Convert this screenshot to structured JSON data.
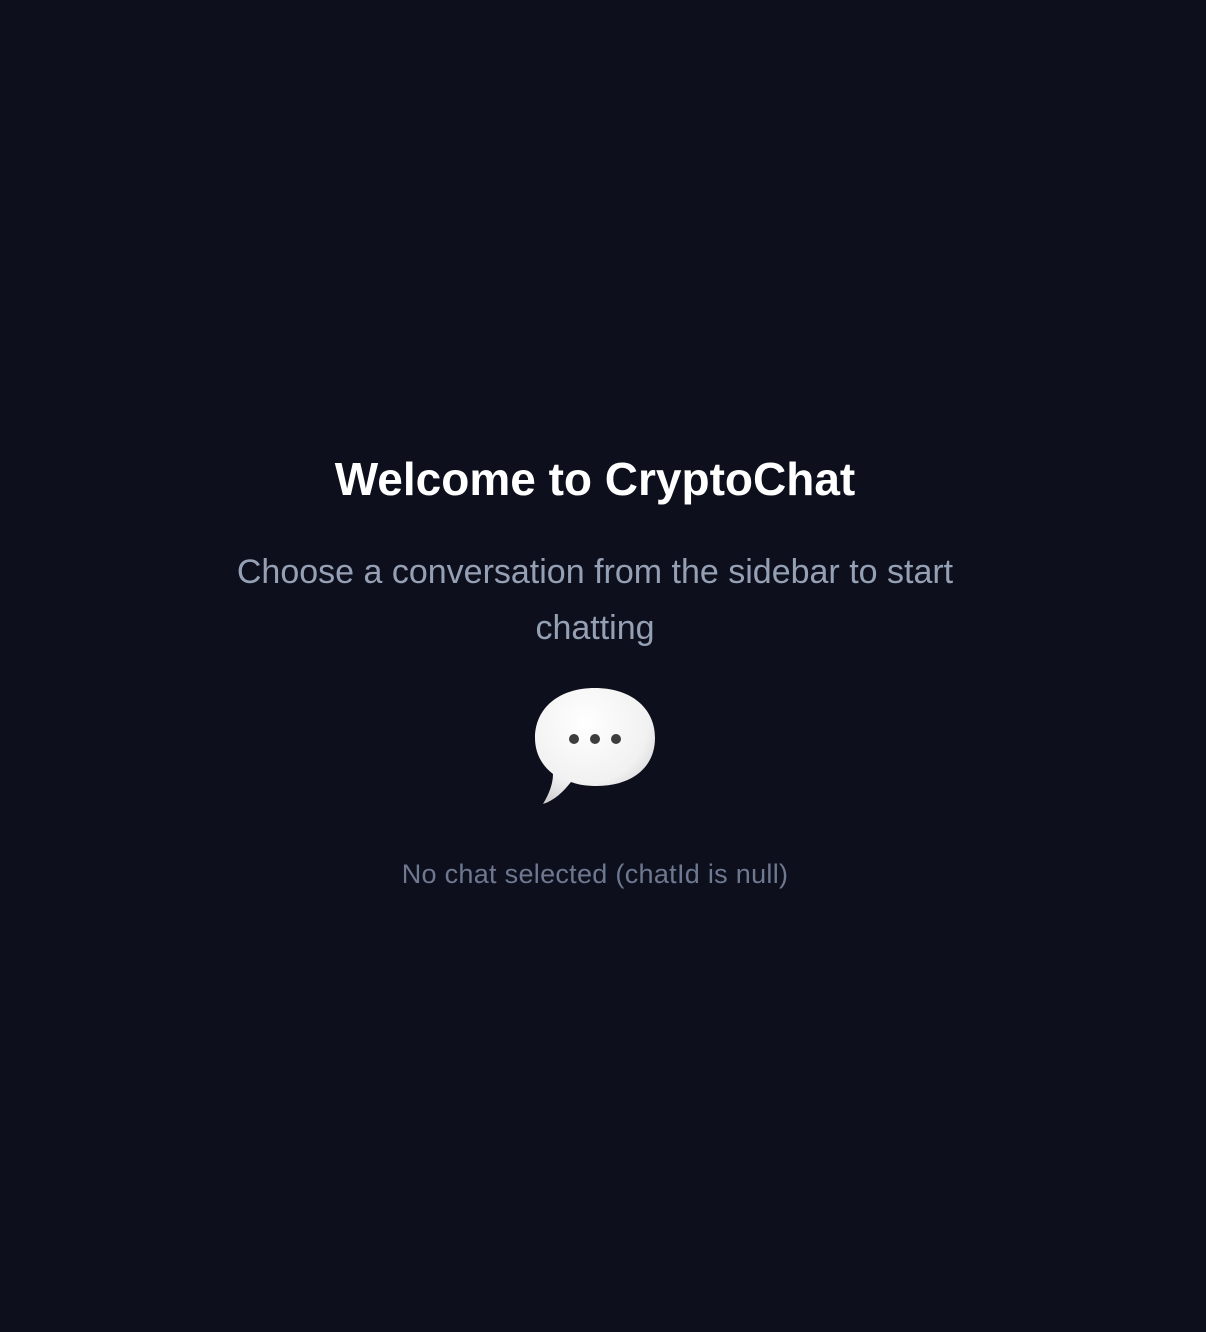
{
  "welcome": {
    "title": "Welcome to CryptoChat",
    "subtitle": "Choose a conversation from the sidebar to start chatting",
    "icon": "speech-bubble-icon",
    "status": "No chat selected (chatId is null)"
  },
  "colors": {
    "background": "#0d101c",
    "title": "#ffffff",
    "subtitle": "#95a0b5",
    "status": "#6e7890"
  }
}
